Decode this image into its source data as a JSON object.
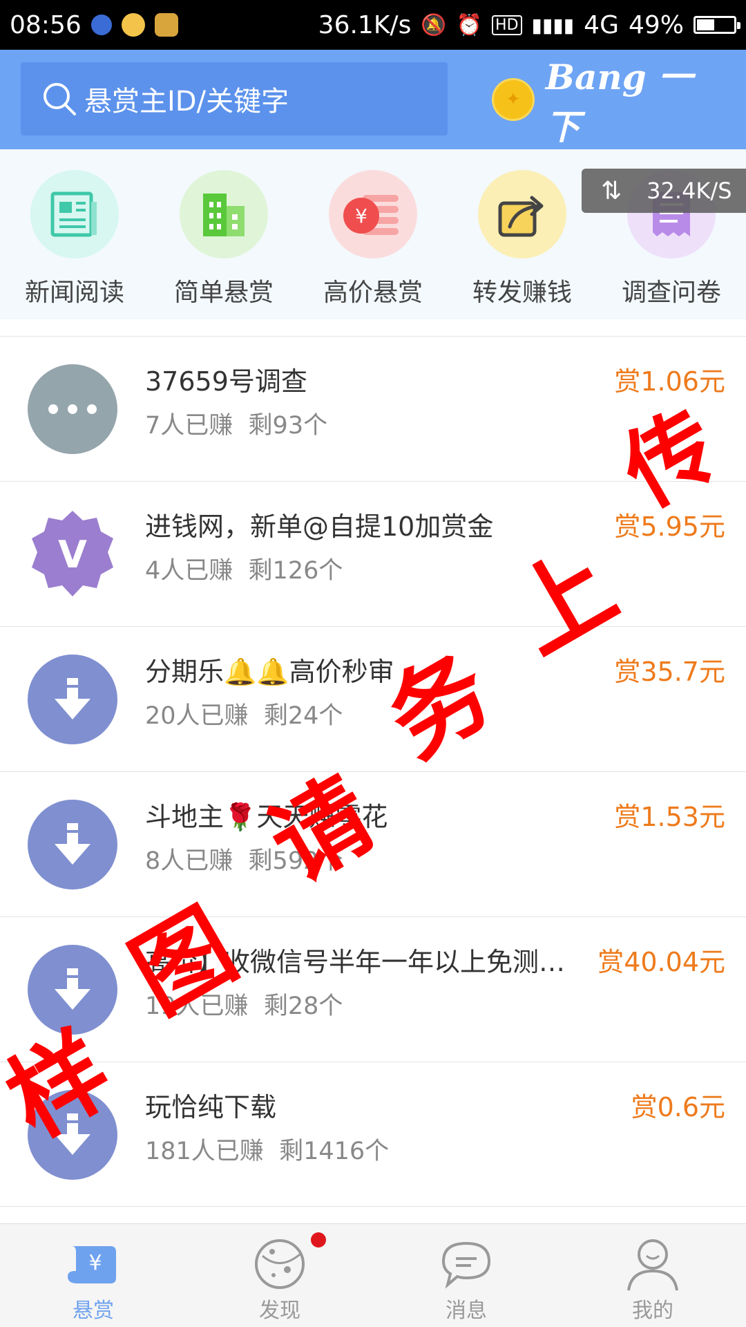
{
  "status_bar": {
    "time": "08:56",
    "net_speed": "36.1K/s",
    "network_type": "4G",
    "hd_label": "HD",
    "battery_text": "49%",
    "battery_level": 0.49
  },
  "header": {
    "search_placeholder": "悬赏主ID/关键字",
    "bang_button_label": "Bang 一下"
  },
  "categories": [
    {
      "label": "新闻阅读",
      "icon": "newspaper-icon",
      "bg": "#d7f7f0",
      "color": "#3fc8a9"
    },
    {
      "label": "简单悬赏",
      "icon": "building-icon",
      "bg": "#e0f5d8",
      "color": "#59c93b"
    },
    {
      "label": "高价悬赏",
      "icon": "yuan-stack-icon",
      "bg": "#fbdcdc",
      "color": "#f04e4e"
    },
    {
      "label": "转发赚钱",
      "icon": "share-icon",
      "bg": "#fbefb6",
      "color": "#f3b91c"
    },
    {
      "label": "调查问卷",
      "icon": "survey-icon",
      "bg": "#efe0fa",
      "color": "#a26de0"
    }
  ],
  "speed_badge": "32.4K/S",
  "tasks": [
    {
      "title": "37659号调查",
      "earned": "7人已赚",
      "remaining": "剩93个",
      "reward": "赏1.06元",
      "avatar": "more-dots-icon",
      "avatar_color": "#95a5ac"
    },
    {
      "title": "进钱网，新单@自提10加赏金",
      "earned": "4人已赚",
      "remaining": "剩126个",
      "reward": "赏5.95元",
      "avatar": "v-badge-icon",
      "avatar_color": "#9b7ecf"
    },
    {
      "title": "分期乐🔔🔔高价秒审",
      "earned": "20人已赚",
      "remaining": "剩24个",
      "reward": "赏35.7元",
      "avatar": "download-icon",
      "avatar_color": "#7f8fd0"
    },
    {
      "title": "斗地主🌹天天赚零花",
      "earned": "8人已赚",
      "remaining": "剩592个",
      "reward": "赏1.53元",
      "avatar": "download-icon",
      "avatar_color": "#7f8fd0"
    },
    {
      "title": "高价】收微信号半年一年以上免测…",
      "earned": "19人已赚",
      "remaining": "剩28个",
      "reward": "赏40.04元",
      "avatar": "download-icon",
      "avatar_color": "#7f8fd0"
    },
    {
      "title": "玩恰纯下载",
      "earned": "181人已赚",
      "remaining": "剩1416个",
      "reward": "赏0.6元",
      "avatar": "download-icon",
      "avatar_color": "#7f8fd0"
    }
  ],
  "tabs": [
    {
      "label": "悬赏",
      "icon": "reward-scroll-icon",
      "active": true
    },
    {
      "label": "发现",
      "icon": "planet-icon",
      "active": false
    },
    {
      "label": "消息",
      "icon": "chat-bubble-icon",
      "active": false
    },
    {
      "label": "我的",
      "icon": "user-smile-icon",
      "active": false
    }
  ],
  "watermark_chars": [
    "传",
    "上",
    "务",
    "请",
    "图",
    "样"
  ]
}
